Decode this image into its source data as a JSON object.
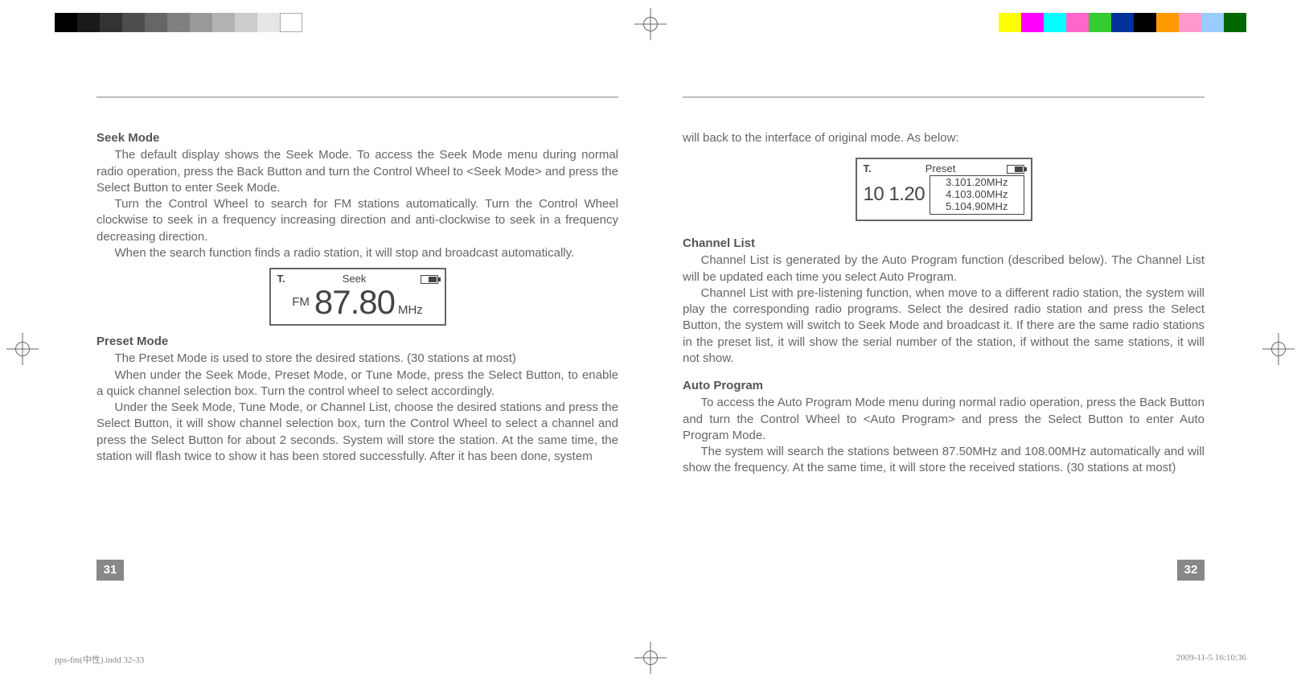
{
  "colorbars": {
    "left": [
      "#000",
      "#1a1a1a",
      "#333",
      "#4d4d4d",
      "#666",
      "#808080",
      "#999",
      "#b3b3b3",
      "#ccc",
      "#e6e6e6",
      "#fff"
    ],
    "right": [
      "#ff0",
      "#f0f",
      "#0ff",
      "#f6c",
      "#3c3",
      "#039",
      "#000",
      "#f90",
      "#f9c",
      "#9cf",
      "#060"
    ]
  },
  "left_page": {
    "seek_heading": "Seek Mode",
    "seek_p1": "The default display shows the Seek Mode. To access the Seek Mode menu during normal radio operation, press the Back Button and turn the Control Wheel to <Seek Mode> and press the Select Button to enter Seek Mode.",
    "seek_p2": "Turn the Control Wheel to search for FM stations automatically. Turn the Control Wheel clockwise to seek in a frequency increasing direction and anti-clockwise to seek in a frequency decreasing direction.",
    "seek_p3": "When the search function finds a radio station, it will stop and broadcast automatically.",
    "lcd_seek": {
      "mode": "Seek",
      "band": "FM",
      "freq": "87.80",
      "unit": "MHz"
    },
    "preset_heading": "Preset Mode",
    "preset_p1": "The Preset Mode is used to store the desired stations. (30 stations at most)",
    "preset_p2": "When under the Seek Mode, Preset Mode, or Tune Mode, press the Select Button, to enable a quick channel selection box. Turn the control wheel to select accordingly.",
    "preset_p3": "Under the Seek Mode, Tune Mode, or Channel List, choose the desired stations and press the Select Button, it will show channel selection box, turn the Control Wheel to select a channel and press the Select Button for about 2 seconds. System will store the station. At the same time, the station will flash twice to show it has been stored successfully. After it has been done, system",
    "page_num": "31"
  },
  "right_page": {
    "cont_p": "will back to the interface of original mode. As below:",
    "lcd_preset": {
      "mode": "Preset",
      "left_num": "10 1.20",
      "row1": "3.101.20MHz",
      "row2": "4.103.00MHz",
      "row3": "5.104.90MHz"
    },
    "chlist_heading": "Channel List",
    "chlist_p1": "Channel List is generated by the Auto Program function (described below). The Channel List will be updated each time you select Auto Program.",
    "chlist_p2": "Channel List with pre-listening function, when move to a different radio station, the system will play the corresponding radio programs. Select the desired radio station and press the Select Button, the system will switch to Seek Mode and broadcast it. If there are the same radio stations in the preset list, it will show the serial number of the station, if without the same stations, it will not show.",
    "auto_heading": "Auto Program",
    "auto_p1": "To access the Auto Program Mode menu during normal radio operation, press the Back Button and turn the Control Wheel to <Auto Program> and press the Select Button to enter Auto Program Mode.",
    "auto_p2": "The system will search the stations between 87.50MHz and 108.00MHz automatically and will show the frequency. At the same time, it will store the received stations. (30 stations at most)",
    "page_num": "32"
  },
  "footer": {
    "file": "pps-fm(中性).indd   32-33",
    "stamp": "2009-11-5   16:10:36"
  }
}
